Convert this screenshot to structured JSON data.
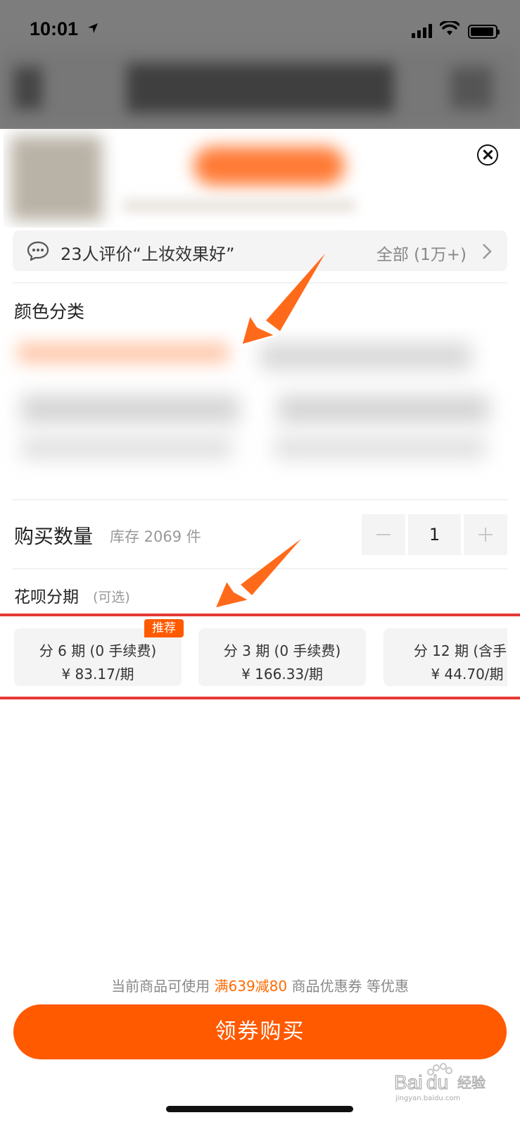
{
  "status_bar": {
    "time": "10:01"
  },
  "review": {
    "text": "23人评价“上妆效果好”",
    "all_label": "全部 (1万+)"
  },
  "color_section": {
    "title": "颜色分类"
  },
  "quantity": {
    "label": "购买数量",
    "stock": "库存 2069 件",
    "value": "1"
  },
  "installment": {
    "title": "花呗分期",
    "optional": "(可选)",
    "badge": "推荐",
    "plans": [
      {
        "line1": "分 6 期 (0 手续费)",
        "line2": "¥ 83.17/期"
      },
      {
        "line1": "分 3 期 (0 手续费)",
        "line2": "¥ 166.33/期"
      },
      {
        "line1": "分 12 期 (含手续",
        "line2": "¥ 44.70/期"
      }
    ]
  },
  "coupon": {
    "prefix": "当前商品可使用",
    "highlight": "满639减80",
    "suffix": "商品优惠券 等优惠"
  },
  "buy_button": {
    "label": "领券购买"
  },
  "watermark": {
    "text": "Baidu经验",
    "sub": "jingyan.baidu.com"
  },
  "colors": {
    "accent": "#ff5a00",
    "annotation_red": "#e53935"
  }
}
